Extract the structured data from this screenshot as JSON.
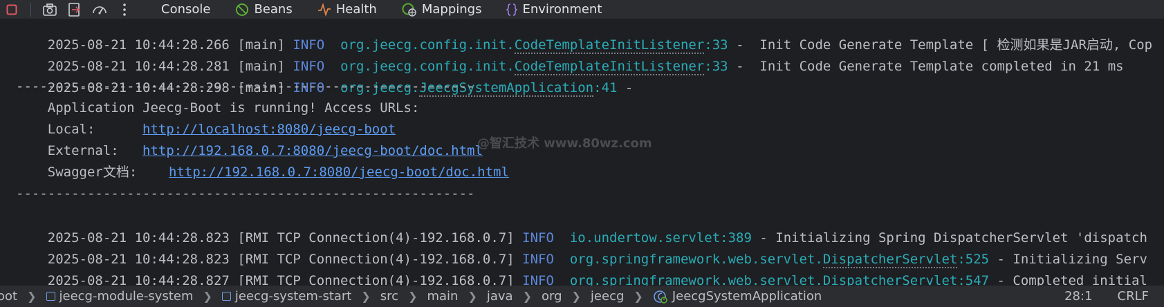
{
  "toolbar": {
    "tabs": [
      {
        "label": "Console",
        "icon": "none"
      },
      {
        "label": "Beans",
        "icon": "beans-icon"
      },
      {
        "label": "Health",
        "icon": "health-icon"
      },
      {
        "label": "Mappings",
        "icon": "mappings-icon"
      },
      {
        "label": "Environment",
        "icon": "environment-icon"
      }
    ]
  },
  "console": {
    "line1": {
      "date": "2025-08-21 10:44:28.266",
      "thread": "[main]",
      "level": "INFO",
      "pkg": "org.jeecg.config.init.",
      "cls": "CodeTemplateInitListener",
      "lineno": ":33",
      "sep": " -  ",
      "msg": "Init Code Generate Template [ 检测如果是JAR启动, Cop"
    },
    "line2": {
      "date": "2025-08-21 10:44:28.281",
      "thread": "[main]",
      "level": "INFO",
      "pkg": "org.jeecg.config.init.",
      "cls": "CodeTemplateInitListener",
      "lineno": ":33",
      "sep": " -  ",
      "msg": "Init Code Generate Template completed in 21 ms"
    },
    "line3": {
      "date": "2025-08-21 10:44:28.298",
      "thread": "[main]",
      "level": "INFO",
      "pkg": "org.jeecg.",
      "cls": "JeecgSystemApplication",
      "lineno": ":41",
      "sep": " -",
      "msg": ""
    },
    "divider": "----------------------------------------------------------",
    "banner_title": "    Application Jeecg-Boot is running! Access URLs:",
    "local_label": "    Local:      ",
    "local_url": "http://localhost:8080/jeecg-boot",
    "external_label": "    External:   ",
    "external_url": "http://192.168.0.7:8080/jeecg-boot/doc.html",
    "swagger_label": "    Swagger文档:    ",
    "swagger_url": "http://192.168.0.7:8080/jeecg-boot/doc.html",
    "line4": {
      "date": "2025-08-21 10:44:28.823",
      "thread": "[RMI TCP Connection(4)-192.168.0.7]",
      "level": "INFO",
      "pkg": "io.undertow.servlet",
      "cls": "",
      "lineno": ":389",
      "sep": " - ",
      "msg": "Initializing Spring DispatcherServlet 'dispatch"
    },
    "line5": {
      "date": "2025-08-21 10:44:28.823",
      "thread": "[RMI TCP Connection(4)-192.168.0.7]",
      "level": "INFO",
      "pkg": "org.springframework.web.servlet.",
      "cls": "DispatcherServlet",
      "lineno": ":525",
      "sep": " - ",
      "msg": "Initializing Serv"
    },
    "line6": {
      "date": "2025-08-21 10:44:28.827",
      "thread": "[RMI TCP Connection(4)-192.168.0.7]",
      "level": "INFO",
      "pkg": "org.springframework.web.servlet.",
      "cls": "DispatcherServlet",
      "lineno": ":547",
      "sep": " - ",
      "msg": "Completed initial"
    },
    "watermark": "@智汇技术  www.80wz.com"
  },
  "statusbar": {
    "crumbs": [
      "oot",
      "jeecg-module-system",
      "jeecg-system-start",
      "src",
      "main",
      "java",
      "org",
      "jeecg",
      "JeecgSystemApplication"
    ],
    "position": "28:1",
    "line_ending": "CRLF"
  },
  "colors": {
    "background": "#1e1f22",
    "logger": "#2aacb8",
    "info": "#5c87db",
    "link": "#5c9cf5"
  }
}
